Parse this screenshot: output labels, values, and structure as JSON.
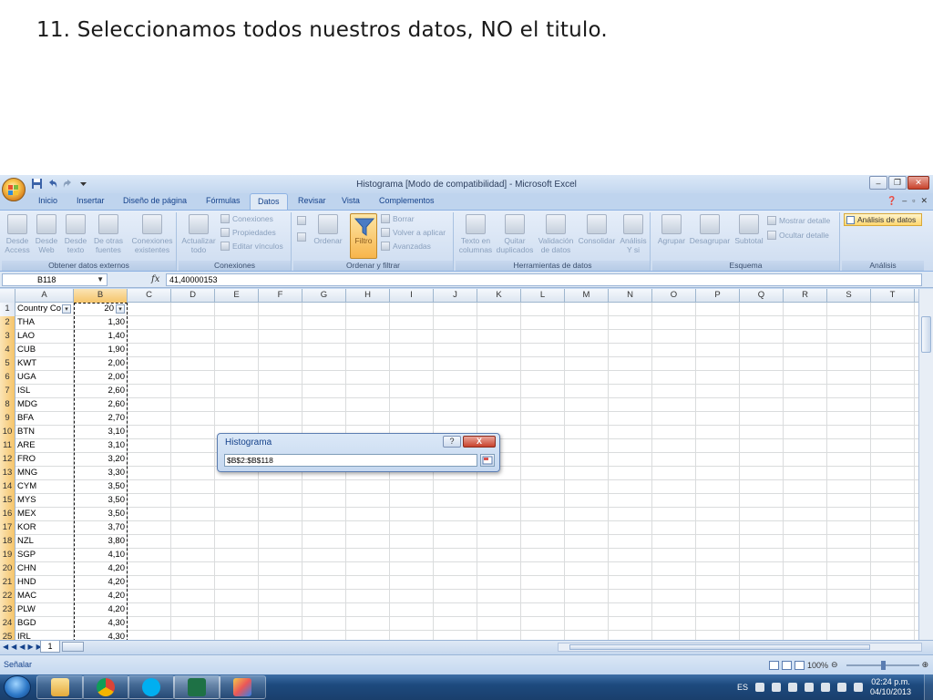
{
  "slide": {
    "title": "11. Seleccionamos todos nuestros datos, NO el titulo."
  },
  "window": {
    "title": "Histograma  [Modo de compatibilidad] - Microsoft Excel"
  },
  "tabs": [
    "Inicio",
    "Insertar",
    "Diseño de página",
    "Fórmulas",
    "Datos",
    "Revisar",
    "Vista",
    "Complementos"
  ],
  "active_tab": "Datos",
  "ribbon": {
    "groups": {
      "obtener": "Obtener datos externos",
      "conexiones": "Conexiones",
      "ordenar": "Ordenar y filtrar",
      "herramientas": "Herramientas de datos",
      "esquema": "Esquema",
      "analisis": "Análisis"
    },
    "buttons": {
      "desde_access": "Desde Access",
      "desde_web": "Desde Web",
      "desde_texto": "Desde texto",
      "otras_fuentes": "De otras fuentes",
      "conexiones_existentes": "Conexiones existentes",
      "actualizar_todo": "Actualizar todo",
      "conexiones": "Conexiones",
      "propiedades": "Propiedades",
      "editar_vinculos": "Editar vínculos",
      "ordenar": "Ordenar",
      "filtro": "Filtro",
      "borrar": "Borrar",
      "volver_aplicar": "Volver a aplicar",
      "avanzadas": "Avanzadas",
      "texto_columnas": "Texto en columnas",
      "quitar_duplicados": "Quitar duplicados",
      "validacion": "Validación de datos",
      "consolidar": "Consolidar",
      "analisis_y_si": "Análisis Y si",
      "agrupar": "Agrupar",
      "desagrupar": "Desagrupar",
      "subtotal": "Subtotal",
      "mostrar_detalle": "Mostrar detalle",
      "ocultar_detalle": "Ocultar detalle",
      "analisis_datos": "Análisis de datos"
    }
  },
  "formula_bar": {
    "name_box": "B118",
    "fx": "fx",
    "value": "41,40000153"
  },
  "dialog": {
    "title": "Histograma",
    "help": "?",
    "close": "X",
    "range_value": "$B$2:$B$118"
  },
  "columns": [
    "A",
    "B",
    "C",
    "D",
    "E",
    "F",
    "G",
    "H",
    "I",
    "J",
    "K",
    "L",
    "M",
    "N",
    "O",
    "P",
    "Q",
    "R",
    "S",
    "T"
  ],
  "rows": [
    {
      "n": "1",
      "a": "Country Co",
      "b": "20"
    },
    {
      "n": "2",
      "a": "THA",
      "b": "1,30"
    },
    {
      "n": "3",
      "a": "LAO",
      "b": "1,40"
    },
    {
      "n": "4",
      "a": "CUB",
      "b": "1,90"
    },
    {
      "n": "5",
      "a": "KWT",
      "b": "2,00"
    },
    {
      "n": "6",
      "a": "UGA",
      "b": "2,00"
    },
    {
      "n": "7",
      "a": "ISL",
      "b": "2,60"
    },
    {
      "n": "8",
      "a": "MDG",
      "b": "2,60"
    },
    {
      "n": "9",
      "a": "BFA",
      "b": "2,70"
    },
    {
      "n": "10",
      "a": "BTN",
      "b": "3,10"
    },
    {
      "n": "11",
      "a": "ARE",
      "b": "3,10"
    },
    {
      "n": "12",
      "a": "FRO",
      "b": "3,20"
    },
    {
      "n": "13",
      "a": "MNG",
      "b": "3,30"
    },
    {
      "n": "14",
      "a": "CYM",
      "b": "3,50"
    },
    {
      "n": "15",
      "a": "MYS",
      "b": "3,50"
    },
    {
      "n": "16",
      "a": "MEX",
      "b": "3,50"
    },
    {
      "n": "17",
      "a": "KOR",
      "b": "3,70"
    },
    {
      "n": "18",
      "a": "NZL",
      "b": "3,80"
    },
    {
      "n": "19",
      "a": "SGP",
      "b": "4,10"
    },
    {
      "n": "20",
      "a": "CHN",
      "b": "4,20"
    },
    {
      "n": "21",
      "a": "HND",
      "b": "4,20"
    },
    {
      "n": "22",
      "a": "MAC",
      "b": "4,20"
    },
    {
      "n": "23",
      "a": "PLW",
      "b": "4,20"
    },
    {
      "n": "24",
      "a": "BGD",
      "b": "4,30"
    },
    {
      "n": "25",
      "a": "IRL",
      "b": "4,30"
    }
  ],
  "sheet": {
    "tab": "1"
  },
  "status": {
    "text": "Señalar",
    "zoom": "100%"
  },
  "taskbar": {
    "lang": "ES",
    "time": "02:24 p.m.",
    "date": "04/10/2013"
  }
}
